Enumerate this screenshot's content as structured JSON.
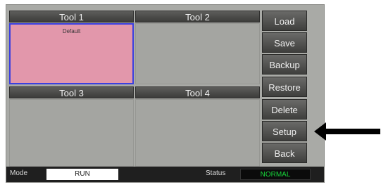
{
  "tools": [
    {
      "label": "Tool 1",
      "program": "Default"
    },
    {
      "label": "Tool 2",
      "program": ""
    },
    {
      "label": "Tool 3",
      "program": ""
    },
    {
      "label": "Tool 4",
      "program": ""
    }
  ],
  "side_buttons": {
    "load": "Load",
    "save": "Save",
    "backup": "Backup",
    "restore": "Restore",
    "delete": "Delete",
    "setup": "Setup",
    "back": "Back"
  },
  "status_bar": {
    "mode_label": "Mode",
    "mode_value": "RUN",
    "status_label": "Status",
    "status_value": "NORMAL"
  },
  "colors": {
    "selected_tool_fill": "#e297ab",
    "selected_tool_border": "#3b3fe0",
    "status_ok": "#17d63a"
  },
  "annotation": {
    "icon": "arrow-left-icon"
  }
}
